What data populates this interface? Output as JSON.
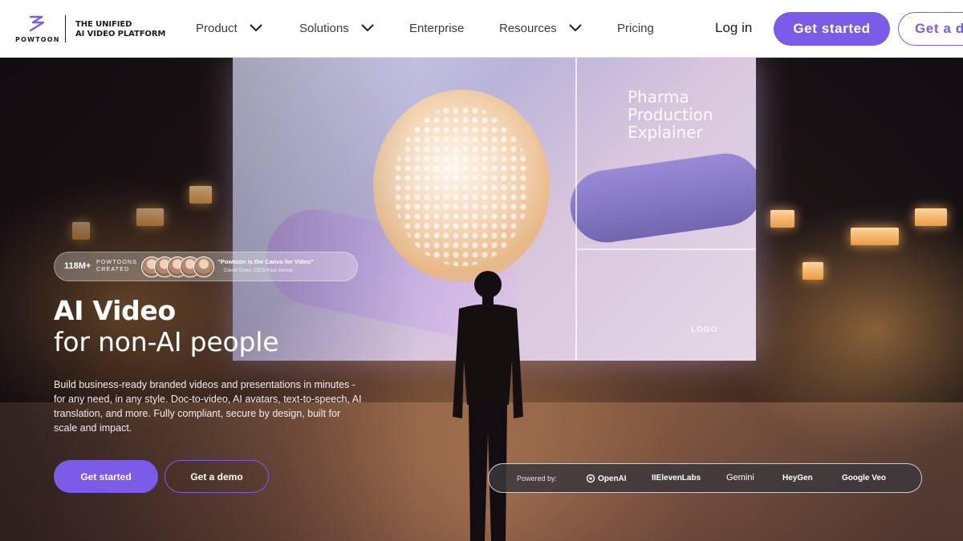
{
  "brand": {
    "wordmark": "POWTOON",
    "tagline_line1": "THE UNIFIED",
    "tagline_line2": "AI VIDEO PLATFORM",
    "accent": "#7a5ce8"
  },
  "nav": {
    "items": [
      {
        "label": "Product",
        "has_dropdown": true
      },
      {
        "label": "Solutions",
        "has_dropdown": true
      },
      {
        "label": "Enterprise",
        "has_dropdown": false
      },
      {
        "label": "Resources",
        "has_dropdown": true
      },
      {
        "label": "Pricing",
        "has_dropdown": false
      }
    ],
    "login_label": "Log in",
    "get_started_label": "Get started",
    "demo_label": "Get a demo"
  },
  "hero": {
    "screen_title": "Pharma Production Explainer",
    "screen_logo": "LOGO",
    "proof": {
      "count": "118M+",
      "label_line1": "POWTOONS",
      "label_line2": "CREATED",
      "quote": "“Powtoon is the Canva for Video”",
      "author": "David Suter, CEO Fast Sense"
    },
    "headline_bold": "AI Video",
    "headline_light": "for non-AI people",
    "description": "Build business-ready branded videos and presentations in minutes - for any need, in any style. Doc-to-video, AI avatars, text-to-speech, AI translation, and more. Fully compliant, secure by design, built for scale and impact.",
    "cta_primary": "Get started",
    "cta_secondary": "Get a demo",
    "powered_by": {
      "label": "Powered by:",
      "partners": [
        "OpenAI",
        "IIElevenLabs",
        "Gemini",
        "HeyGen",
        "Google Veo"
      ]
    }
  },
  "icons": [
    "powtoon-logo-icon",
    "chevron-down-icon",
    "openai-icon",
    "person-silhouette"
  ]
}
